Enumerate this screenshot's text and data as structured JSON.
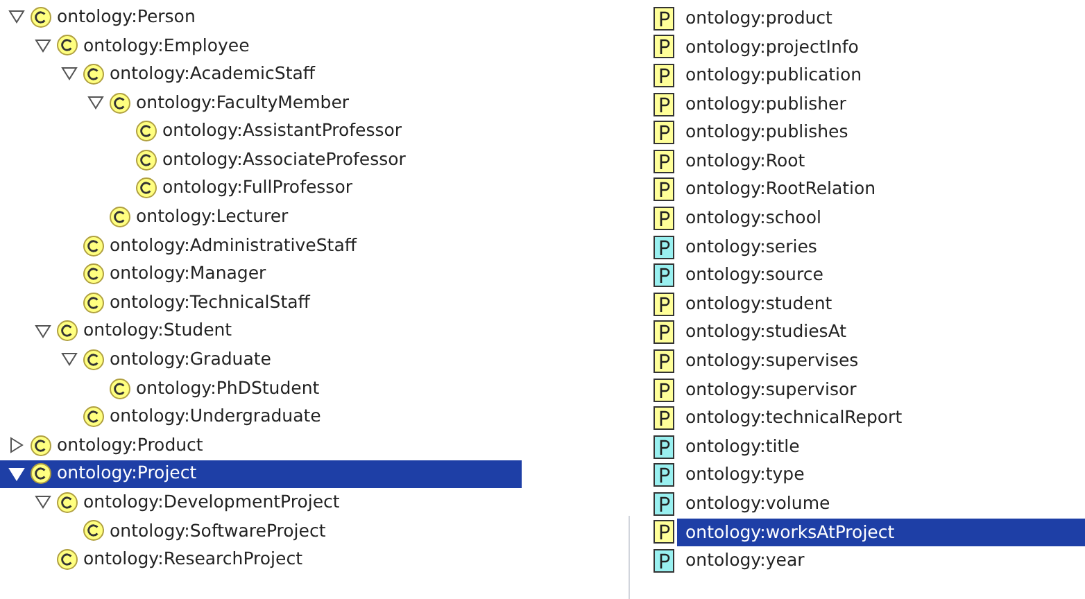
{
  "class_tree": [
    {
      "label": "ontology:Person",
      "expanded": true,
      "selected": false,
      "children": [
        {
          "label": "ontology:Employee",
          "expanded": true,
          "selected": false,
          "children": [
            {
              "label": "ontology:AcademicStaff",
              "expanded": true,
              "selected": false,
              "children": [
                {
                  "label": "ontology:FacultyMember",
                  "expanded": true,
                  "selected": false,
                  "children": [
                    {
                      "label": "ontology:AssistantProfessor",
                      "selected": false
                    },
                    {
                      "label": "ontology:AssociateProfessor",
                      "selected": false
                    },
                    {
                      "label": "ontology:FullProfessor",
                      "selected": false
                    }
                  ]
                },
                {
                  "label": "ontology:Lecturer",
                  "selected": false
                }
              ]
            },
            {
              "label": "ontology:AdministrativeStaff",
              "selected": false
            },
            {
              "label": "ontology:Manager",
              "selected": false
            },
            {
              "label": "ontology:TechnicalStaff",
              "selected": false
            }
          ]
        },
        {
          "label": "ontology:Student",
          "expanded": true,
          "selected": false,
          "children": [
            {
              "label": "ontology:Graduate",
              "expanded": true,
              "selected": false,
              "children": [
                {
                  "label": "ontology:PhDStudent",
                  "selected": false
                }
              ]
            },
            {
              "label": "ontology:Undergraduate",
              "selected": false
            }
          ]
        }
      ]
    },
    {
      "label": "ontology:Product",
      "expanded": false,
      "selected": false
    },
    {
      "label": "ontology:Project",
      "expanded": true,
      "selected": true,
      "children": [
        {
          "label": "ontology:DevelopmentProject",
          "expanded": true,
          "selected": false,
          "children": [
            {
              "label": "ontology:SoftwareProject",
              "selected": false
            }
          ]
        },
        {
          "label": "ontology:ResearchProject",
          "selected": false
        }
      ]
    }
  ],
  "property_list": [
    {
      "label": "ontology:product",
      "color": "#ffff99",
      "selected": false
    },
    {
      "label": "ontology:projectInfo",
      "color": "#ffff99",
      "selected": false
    },
    {
      "label": "ontology:publication",
      "color": "#ffff99",
      "selected": false
    },
    {
      "label": "ontology:publisher",
      "color": "#ffff99",
      "selected": false
    },
    {
      "label": "ontology:publishes",
      "color": "#ffff99",
      "selected": false
    },
    {
      "label": "ontology:Root",
      "color": "#ffff99",
      "selected": false
    },
    {
      "label": "ontology:RootRelation",
      "color": "#ffff99",
      "selected": false
    },
    {
      "label": "ontology:school",
      "color": "#ffff99",
      "selected": false
    },
    {
      "label": "ontology:series",
      "color": "#99f0f0",
      "selected": false
    },
    {
      "label": "ontology:source",
      "color": "#99f0f0",
      "selected": false
    },
    {
      "label": "ontology:student",
      "color": "#ffff99",
      "selected": false
    },
    {
      "label": "ontology:studiesAt",
      "color": "#ffff99",
      "selected": false
    },
    {
      "label": "ontology:supervises",
      "color": "#ffff99",
      "selected": false
    },
    {
      "label": "ontology:supervisor",
      "color": "#ffff99",
      "selected": false
    },
    {
      "label": "ontology:technicalReport",
      "color": "#ffff99",
      "selected": false
    },
    {
      "label": "ontology:title",
      "color": "#99f0f0",
      "selected": false
    },
    {
      "label": "ontology:type",
      "color": "#99f0f0",
      "selected": false
    },
    {
      "label": "ontology:volume",
      "color": "#99f0f0",
      "selected": false
    },
    {
      "label": "ontology:worksAtProject",
      "color": "#ffff99",
      "selected": true
    },
    {
      "label": "ontology:year",
      "color": "#99f0f0",
      "selected": false
    }
  ]
}
